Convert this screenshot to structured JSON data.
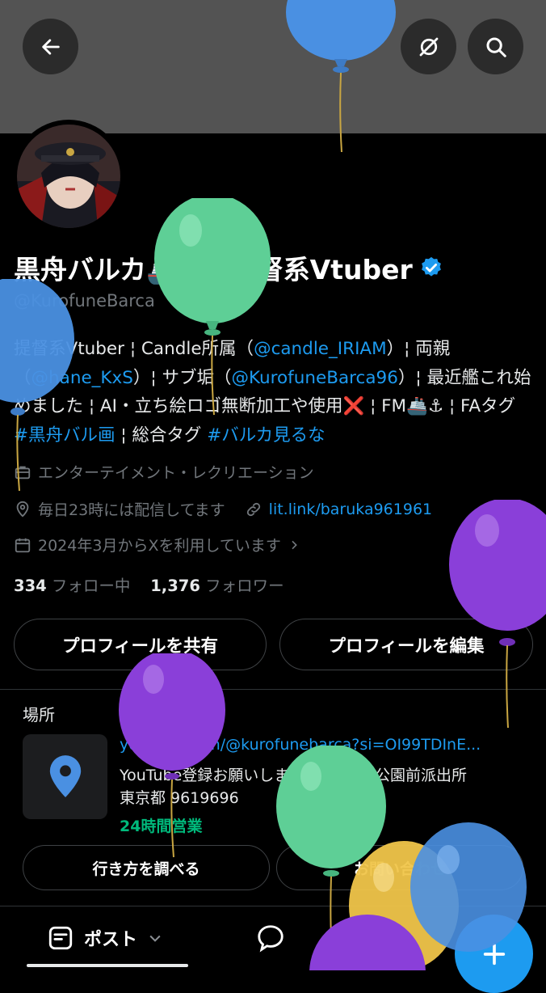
{
  "profile": {
    "name": "黒舟バルカ🚢⚓@提督系Vtuber",
    "handle": "@KurofuneBarca",
    "bio": {
      "p1": "提督系Vtuber ¦ Candle所属（",
      "l1": "@candle_IRIAM",
      "p2": "）¦ 両親（",
      "l2": "@hane_KxS",
      "p3": "）¦ サブ垢（",
      "l3": "@KurofuneBarca96",
      "p4": "）¦ 最近艦これ始めました ¦ AI・立ち絵ロゴ無断加工や使用❌ ¦ FM🚢⚓ ¦ FAタグ ",
      "l4": "#黒舟バル画",
      "p5": " ¦ 総合タグ ",
      "l5": "#バルカ見るな"
    },
    "category": "エンターテイメント・レクリエーション",
    "location": "毎日23時には配信してます",
    "website": "lit.link/baruka961961",
    "joined": "2024年3月からXを利用しています",
    "following_count": "334",
    "following_label": "フォロー中",
    "followers_count": "1,376",
    "followers_label": "フォロワー"
  },
  "actions": {
    "share": "プロフィールを共有",
    "edit": "プロフィールを編集"
  },
  "location_section": {
    "title": "場所",
    "url": "youtube.com/@kurofunebarca?si=OI99TDInE...",
    "desc_line1": "YouTube登録お願いします🙏 葛飾区公園前派出所",
    "desc_line2": "東京都 9619696",
    "hours": "24時間営業",
    "directions": "行き方を調べる",
    "contact": "お問い合わせ"
  },
  "bottom": {
    "post_label": "ポスト"
  },
  "colors": {
    "accent": "#1d9bf0",
    "hours_green": "#00ba7c",
    "verified": "#1d9bf0"
  }
}
